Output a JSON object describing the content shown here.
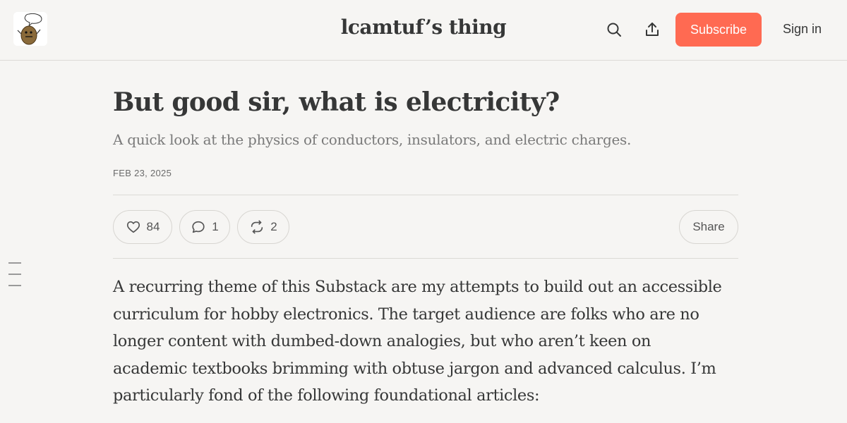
{
  "header": {
    "site_title": "lcamtuf’s thing",
    "subscribe_label": "Subscribe",
    "signin_label": "Sign in",
    "icons": [
      "search-icon",
      "share-upload-icon"
    ]
  },
  "post": {
    "title": "But good sir, what is electricity?",
    "subtitle": "A quick look at the physics of conductors, insulators, and electric charges.",
    "date": "FEB 23, 2025",
    "likes": "84",
    "comments": "1",
    "restacks": "2",
    "share_label": "Share",
    "body_lines": [
      "A recurring theme of this Substack are my attempts to build out an accessible",
      "curriculum for hobby electronics. The target audience are folks who are no",
      "longer content with dumbed-down analogies, but who aren’t keen on",
      "academic textbooks brimming with obtuse jargon and advanced calculus. I’m",
      "particularly fond of the following foundational articles:"
    ]
  },
  "colors": {
    "accent": "#ff6a52",
    "background": "#f6f5f3",
    "text": "#363737",
    "muted": "#7a7a7a"
  }
}
